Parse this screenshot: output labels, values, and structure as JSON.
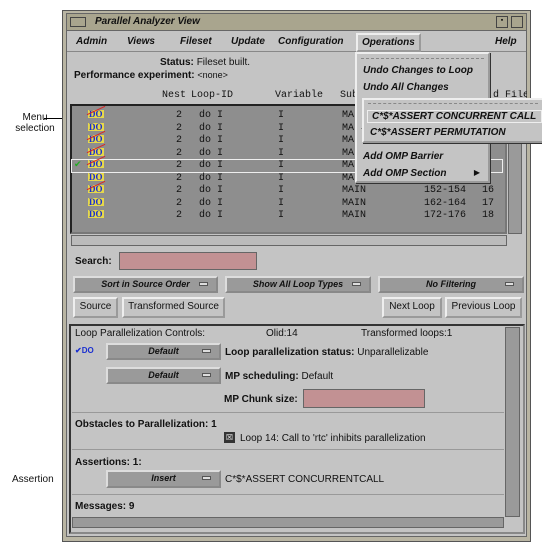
{
  "annotations": {
    "menu_selection": "Menu selection",
    "assertion": "Assertion"
  },
  "window": {
    "title": "Parallel Analyzer View"
  },
  "menubar": [
    "Admin",
    "Views",
    "Fileset",
    "Update",
    "Configuration",
    "Operations",
    "Help"
  ],
  "status": {
    "label": "Status:",
    "value": "Fileset built.",
    "perf_label": "Performance experiment:",
    "perf_value": "<none>"
  },
  "table": {
    "headers": [
      "Nest",
      "Loop-ID",
      "Variable",
      "Sub",
      "d",
      "File"
    ],
    "rows": [
      {
        "nest": "2",
        "loop": "do I",
        "var": "I",
        "sub": "MAIN",
        "lines": "",
        "col": "",
        "parallel": false
      },
      {
        "nest": "2",
        "loop": "do I",
        "var": "I",
        "sub": "MAIN",
        "lines": "",
        "col": "",
        "parallel": true
      },
      {
        "nest": "2",
        "loop": "do I",
        "var": "I",
        "sub": "MAIN",
        "lines": "",
        "col": "",
        "parallel": false
      },
      {
        "nest": "2",
        "loop": "do I",
        "var": "I",
        "sub": "MAIN",
        "lines": "",
        "col": "",
        "parallel": false
      },
      {
        "nest": "2",
        "loop": "do I",
        "var": "I",
        "sub": "MAIN",
        "lines": "",
        "col": "",
        "parallel": false,
        "selected": true
      },
      {
        "nest": "2",
        "loop": "do I",
        "var": "I",
        "sub": "MAIN",
        "lines": "",
        "col": "",
        "parallel": true
      },
      {
        "nest": "2",
        "loop": "do I",
        "var": "I",
        "sub": "MAIN",
        "lines": "152-154",
        "col": "16",
        "parallel": false
      },
      {
        "nest": "2",
        "loop": "do I",
        "var": "I",
        "sub": "MAIN",
        "lines": "162-164",
        "col": "17",
        "parallel": true
      },
      {
        "nest": "2",
        "loop": "do I",
        "var": "I",
        "sub": "MAIN",
        "lines": "172-176",
        "col": "18",
        "parallel": true
      }
    ]
  },
  "operations_menu": [
    "Undo Changes to Loop",
    "Undo All Changes",
    "Add OMP Barrier",
    "Add OMP Section"
  ],
  "submenu": [
    "C*$*ASSERT CONCURRENT CALL",
    "C*$*ASSERT PERMUTATION"
  ],
  "search": {
    "label": "Search:",
    "value": ""
  },
  "options": [
    "Sort in Source Order",
    "Show All Loop Types",
    "No Filtering"
  ],
  "buttons": {
    "source": "Source",
    "transformed": "Transformed Source",
    "next": "Next Loop",
    "previous": "Previous Loop"
  },
  "controls": {
    "header": "Loop Parallelization Controls:",
    "olid": "Olid:14",
    "transformed": "Transformed loops:1",
    "opt1": "Default",
    "status_label": "Loop parallelization status:",
    "status_value": "Unparallelizable",
    "opt2": "Default",
    "sched_label": "MP scheduling:",
    "sched_value": "Default",
    "chunk_label": "MP Chunk size:",
    "chunk_value": "",
    "obstacles": "Obstacles to Parallelization: 1",
    "obstacle_msg": "Loop 14: Call to 'rtc' inhibits parallelization",
    "assertions": "Assertions: 1:",
    "insert": "Insert",
    "assertion_text": "C*$*ASSERT CONCURRENTCALL",
    "messages": "Messages: 9"
  }
}
